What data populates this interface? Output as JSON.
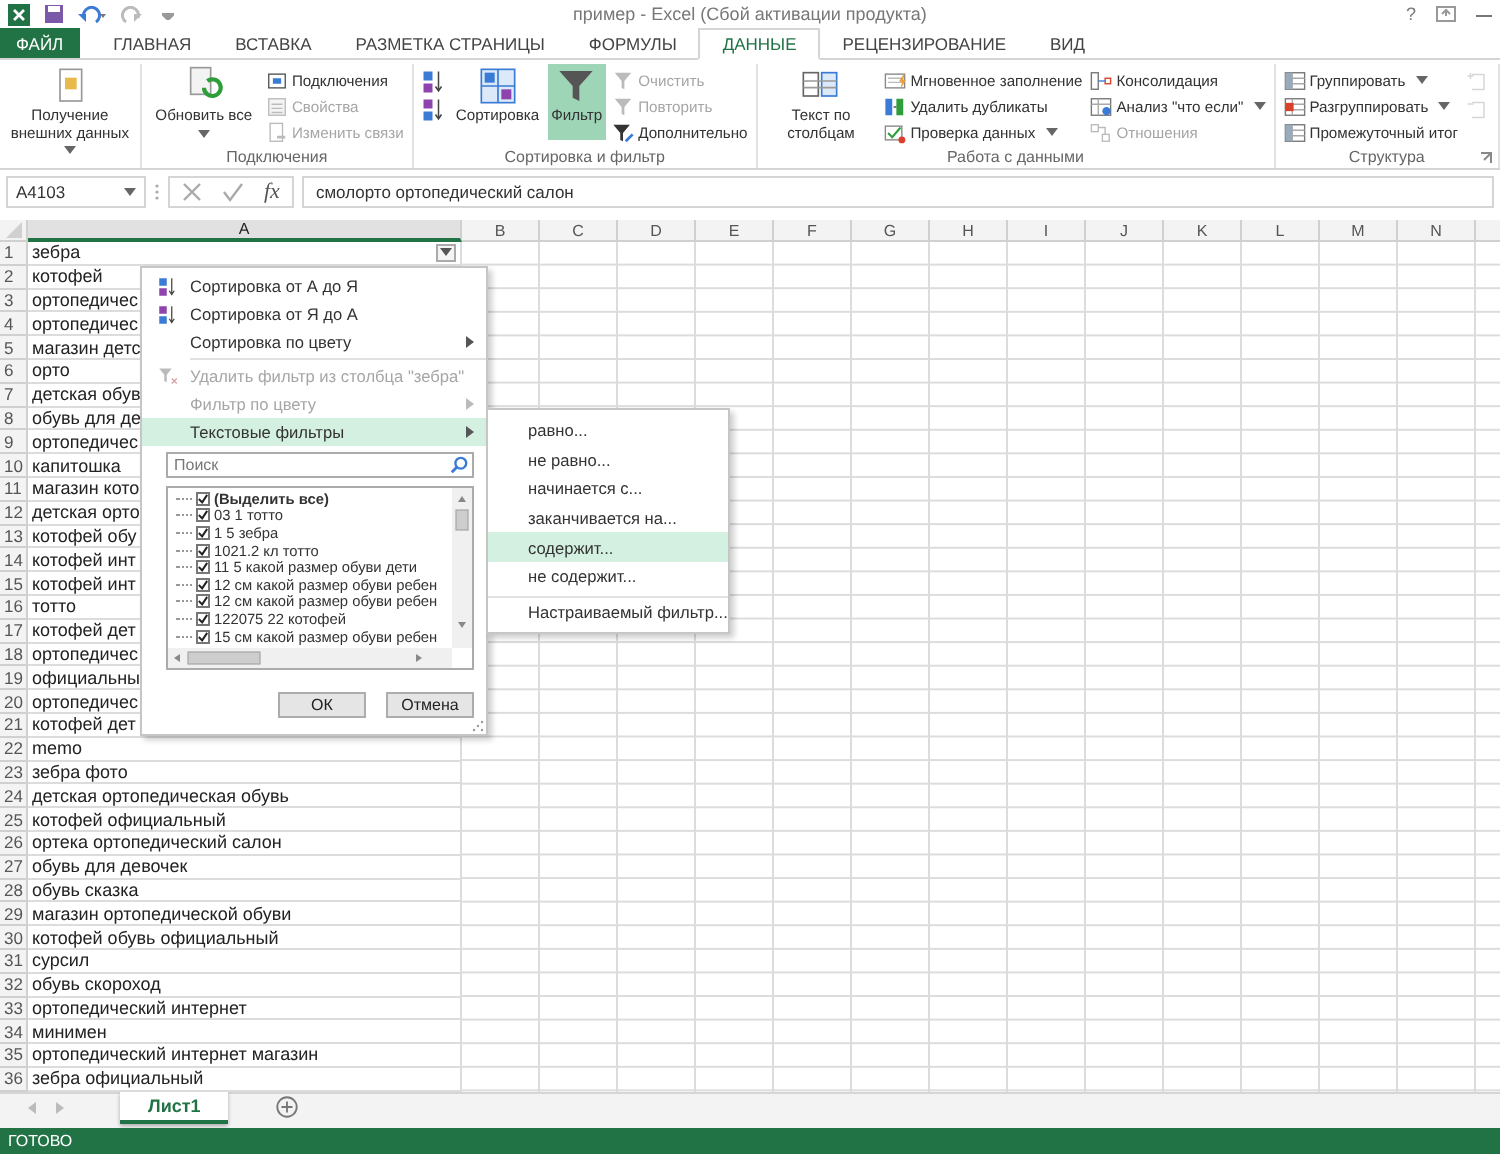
{
  "window": {
    "title": "пример - Excel (Сбой активации продукта)",
    "help": "?"
  },
  "ribbon_tabs": [
    {
      "label": "ФАЙЛ",
      "kind": "file",
      "selected": false
    },
    {
      "label": "ГЛАВНАЯ",
      "kind": "tab",
      "selected": false
    },
    {
      "label": "ВСТАВКА",
      "kind": "tab",
      "selected": false
    },
    {
      "label": "РАЗМЕТКА СТРАНИЦЫ",
      "kind": "tab",
      "selected": false
    },
    {
      "label": "ФОРМУЛЫ",
      "kind": "tab",
      "selected": false
    },
    {
      "label": "ДАННЫЕ",
      "kind": "tab",
      "selected": true
    },
    {
      "label": "РЕЦЕНЗИРОВАНИЕ",
      "kind": "tab",
      "selected": false
    },
    {
      "label": "ВИД",
      "kind": "tab",
      "selected": false
    }
  ],
  "ribbon_groups": [
    {
      "launcher": false,
      "columns": [
        [
          {
            "kind": "large",
            "label": "Получение внешних данных",
            "dropdown": true,
            "disabled": false,
            "pressed": false
          }
        ]
      ]
    },
    {
      "label": "Подключения",
      "launcher": false,
      "columns": [
        [
          {
            "kind": "large",
            "label": "Обновить все",
            "dropdown": true,
            "disabled": false,
            "pressed": false
          }
        ],
        [
          {
            "kind": "small",
            "label": "Подключения",
            "dropdown": false,
            "disabled": false,
            "pressed": false
          },
          {
            "kind": "small",
            "label": "Свойства",
            "dropdown": false,
            "disabled": true,
            "pressed": false
          },
          {
            "kind": "small",
            "label": "Изменить связи",
            "dropdown": false,
            "disabled": true,
            "pressed": false
          }
        ]
      ]
    },
    {
      "label": "Сортировка и фильтр",
      "launcher": false,
      "columns": [
        [
          {
            "kind": "icon",
            "disabled": false,
            "pressed": false
          },
          {
            "kind": "icon",
            "disabled": false,
            "pressed": false
          }
        ],
        [
          {
            "kind": "large",
            "label": "Сортировка",
            "dropdown": false,
            "disabled": false,
            "pressed": false
          }
        ],
        [
          {
            "kind": "large",
            "label": "Фильтр",
            "dropdown": false,
            "disabled": false,
            "pressed": true
          }
        ],
        [
          {
            "kind": "small",
            "label": "Очистить",
            "dropdown": false,
            "disabled": true,
            "pressed": false
          },
          {
            "kind": "small",
            "label": "Повторить",
            "dropdown": false,
            "disabled": true,
            "pressed": false
          },
          {
            "kind": "small",
            "label": "Дополнительно",
            "dropdown": false,
            "disabled": false,
            "pressed": false
          }
        ]
      ]
    },
    {
      "label": "Работа с данными",
      "launcher": false,
      "columns": [
        [
          {
            "kind": "large",
            "label": "Текст по столбцам",
            "dropdown": false,
            "disabled": false,
            "pressed": false
          }
        ],
        [
          {
            "kind": "small",
            "label": "Мгновенное заполнение",
            "dropdown": false,
            "disabled": false,
            "pressed": false
          },
          {
            "kind": "small",
            "label": "Удалить дубликаты",
            "dropdown": false,
            "disabled": false,
            "pressed": false
          },
          {
            "kind": "small",
            "label": "Проверка данных",
            "dropdown": true,
            "disabled": false,
            "pressed": false
          }
        ],
        [
          {
            "kind": "small",
            "label": "Консолидация",
            "dropdown": false,
            "disabled": false,
            "pressed": false
          },
          {
            "kind": "small",
            "label": "Анализ \"что если\"",
            "dropdown": true,
            "disabled": false,
            "pressed": false
          },
          {
            "kind": "small",
            "label": "Отношения",
            "dropdown": false,
            "disabled": true,
            "pressed": false
          }
        ]
      ]
    },
    {
      "label": "Структура",
      "launcher": true,
      "columns": [
        [
          {
            "kind": "small",
            "label": "Группировать",
            "dropdown": true,
            "disabled": false,
            "pressed": false
          },
          {
            "kind": "small",
            "label": "Разгруппировать",
            "dropdown": true,
            "disabled": false,
            "pressed": false
          },
          {
            "kind": "small",
            "label": "Промежуточный итог",
            "dropdown": false,
            "disabled": false,
            "pressed": false
          }
        ],
        [
          {
            "kind": "icon",
            "disabled": true,
            "pressed": false
          },
          {
            "kind": "icon",
            "disabled": true,
            "pressed": false
          }
        ]
      ]
    }
  ],
  "formula_bar": {
    "name_box": "A4103",
    "fx": "fx",
    "formula": "смолорто ортопедический салон"
  },
  "columns": [
    {
      "label": "A",
      "selected": true
    },
    {
      "label": "B",
      "selected": false
    },
    {
      "label": "C",
      "selected": false
    },
    {
      "label": "D",
      "selected": false
    },
    {
      "label": "E",
      "selected": false
    },
    {
      "label": "F",
      "selected": false
    },
    {
      "label": "G",
      "selected": false
    },
    {
      "label": "H",
      "selected": false
    },
    {
      "label": "I",
      "selected": false
    },
    {
      "label": "J",
      "selected": false
    },
    {
      "label": "K",
      "selected": false
    },
    {
      "label": "L",
      "selected": false
    },
    {
      "label": "M",
      "selected": false
    },
    {
      "label": "N",
      "selected": false
    }
  ],
  "autofilter": true,
  "rows": [
    {
      "number": "1",
      "a": "зебра"
    },
    {
      "number": "2",
      "a": "котофей"
    },
    {
      "number": "3",
      "a": "ортопедичес"
    },
    {
      "number": "4",
      "a": "ортопедичес"
    },
    {
      "number": "5",
      "a": "магазин детс"
    },
    {
      "number": "6",
      "a": "орто"
    },
    {
      "number": "7",
      "a": "детская обув"
    },
    {
      "number": "8",
      "a": "обувь для де"
    },
    {
      "number": "9",
      "a": "ортопедичес"
    },
    {
      "number": "10",
      "a": "капитошка"
    },
    {
      "number": "11",
      "a": "магазин кото"
    },
    {
      "number": "12",
      "a": "детская орто"
    },
    {
      "number": "13",
      "a": "котофей обу"
    },
    {
      "number": "14",
      "a": "котофей инт"
    },
    {
      "number": "15",
      "a": "котофей инт"
    },
    {
      "number": "16",
      "a": "тотто"
    },
    {
      "number": "17",
      "a": "котофей дет"
    },
    {
      "number": "18",
      "a": "ортопедичес"
    },
    {
      "number": "19",
      "a": "официальны"
    },
    {
      "number": "20",
      "a": "ортопедичес"
    },
    {
      "number": "21",
      "a": "котофей дет"
    },
    {
      "number": "22",
      "a": "memo"
    },
    {
      "number": "23",
      "a": "зебра фото"
    },
    {
      "number": "24",
      "a": "детская ортопедическая обувь"
    },
    {
      "number": "25",
      "a": "котофей официальный"
    },
    {
      "number": "26",
      "a": "ортека ортопедический салон"
    },
    {
      "number": "27",
      "a": "обувь для девочек"
    },
    {
      "number": "28",
      "a": "обувь сказка"
    },
    {
      "number": "29",
      "a": "магазин ортопедической обуви"
    },
    {
      "number": "30",
      "a": "котофей обувь официальный"
    },
    {
      "number": "31",
      "a": "сурсил"
    },
    {
      "number": "32",
      "a": "обувь скороход"
    },
    {
      "number": "33",
      "a": "ортопедический интернет"
    },
    {
      "number": "34",
      "a": "минимен"
    },
    {
      "number": "35",
      "a": "ортопедический интернет магазин"
    },
    {
      "number": "36",
      "a": "зебра официальный"
    }
  ],
  "filter_menu": {
    "items": [
      {
        "kind": "sort_az",
        "label": "Сортировка от А до Я",
        "disabled": false,
        "submenu": false,
        "highlighted": false
      },
      {
        "kind": "sort_za",
        "label": "Сортировка от Я до А",
        "disabled": false,
        "submenu": false,
        "highlighted": false
      },
      {
        "kind": "plain",
        "label": "Сортировка по цвету",
        "disabled": false,
        "submenu": true,
        "highlighted": false
      },
      {
        "kind": "clear",
        "label": "Удалить фильтр из столбца \"зебра\"",
        "disabled": true,
        "submenu": false,
        "highlighted": false
      },
      {
        "kind": "plain",
        "label": "Фильтр по цвету",
        "disabled": true,
        "submenu": true,
        "highlighted": false
      },
      {
        "kind": "plain",
        "label": "Текстовые фильтры",
        "disabled": false,
        "submenu": true,
        "highlighted": true
      }
    ],
    "search": {
      "placeholder": "Поиск"
    },
    "values": [
      {
        "label": "(Выделить все)",
        "checked": true
      },
      {
        "label": "03 1 тотто",
        "checked": true
      },
      {
        "label": "1 5 зебра",
        "checked": true
      },
      {
        "label": "1021.2 кл тотто",
        "checked": true
      },
      {
        "label": "11 5 какой размер обуви дети",
        "checked": true
      },
      {
        "label": "12 см какой размер обуви ребен",
        "checked": true
      },
      {
        "label": "12 см какой размер обуви ребен",
        "checked": true
      },
      {
        "label": "122075 22 котофей",
        "checked": true
      },
      {
        "label": "15 см какой размер обуви ребен",
        "checked": true
      }
    ],
    "buttons": [
      "ОК",
      "Отмена"
    ]
  },
  "text_filter_submenu": [
    {
      "label": "равно...",
      "highlighted": false,
      "separator_before": false
    },
    {
      "label": "не равно...",
      "highlighted": false,
      "separator_before": false
    },
    {
      "label": "начинается с...",
      "highlighted": false,
      "separator_before": false
    },
    {
      "label": "заканчивается на...",
      "highlighted": false,
      "separator_before": false
    },
    {
      "label": "содержит...",
      "highlighted": true,
      "separator_before": false
    },
    {
      "label": "не содержит...",
      "highlighted": false,
      "separator_before": false
    },
    {
      "label": "Настраиваемый фильтр...",
      "highlighted": false,
      "separator_before": true
    }
  ],
  "sheet_tabs": [
    {
      "label": "Лист1",
      "selected": true
    }
  ],
  "status_bar": {
    "text": "ГОТОВО"
  }
}
